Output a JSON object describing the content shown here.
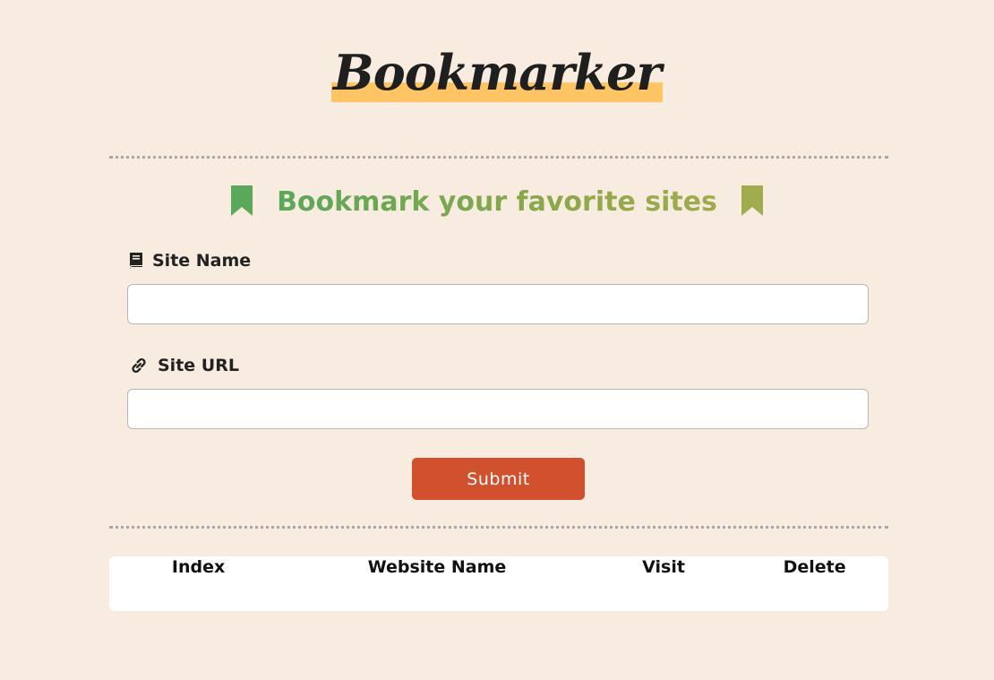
{
  "header": {
    "logo_text": "Bookmarker",
    "highlight_color": "#ffc464"
  },
  "tagline": {
    "text": "Bookmark your favorite sites",
    "left_icon": "bookmark-icon",
    "right_icon": "bookmark-icon",
    "gradient_colors": [
      "#5aa85a",
      "#a0ac4e"
    ]
  },
  "form": {
    "site_name": {
      "label": "Site Name",
      "icon": "book-icon",
      "value": "",
      "placeholder": ""
    },
    "site_url": {
      "label": "Site URL",
      "icon": "link-icon",
      "value": "",
      "placeholder": ""
    },
    "submit_label": "Submit",
    "submit_color": "#d1502d"
  },
  "table": {
    "headers": [
      "Index",
      "Website Name",
      "Visit",
      "Delete"
    ],
    "rows": []
  },
  "theme": {
    "background": "#f8ebdf"
  }
}
